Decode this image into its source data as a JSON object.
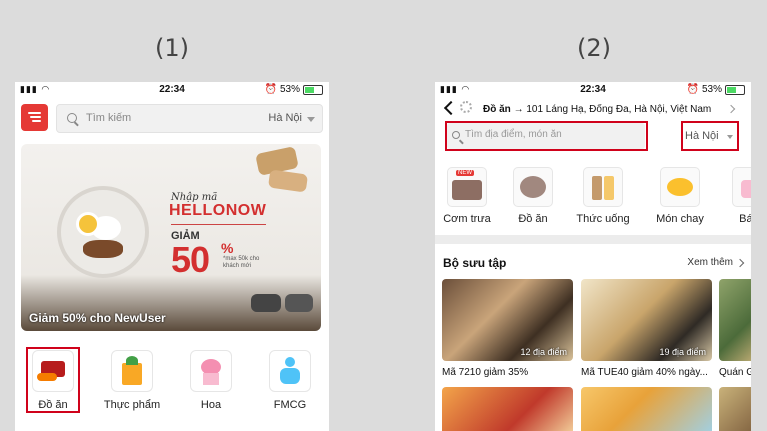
{
  "labels": {
    "left": "(1)",
    "right": "(2)"
  },
  "status": {
    "time": "22:34",
    "battery": "53%"
  },
  "screen1": {
    "search_placeholder": "Tìm kiếm",
    "city": "Hà Nội",
    "banner": {
      "prefix": "Nhập mã",
      "code": "HELLONOW",
      "discount_label": "GIẢM",
      "percent": "50",
      "percent_sign": "%",
      "note": "*max 50k cho khách mới",
      "caption": "Giảm 50% cho NewUser"
    },
    "categories": [
      {
        "label": "Đồ ăn",
        "icon": "food-delivery-icon"
      },
      {
        "label": "Thực phẩm",
        "icon": "grocery-bag-icon"
      },
      {
        "label": "Hoa",
        "icon": "flower-icon"
      },
      {
        "label": "FMCG",
        "icon": "baby-icon"
      }
    ]
  },
  "screen2": {
    "header_category": "Đồ ăn",
    "header_arrow": "→",
    "header_address": "101 Láng Hạ, Đống Đa, Hà Nội, Việt Nam",
    "search_placeholder": "Tìm địa điểm, món ăn",
    "city": "Hà Nội",
    "categories": [
      {
        "label": "Cơm trưa",
        "badge": "NEW"
      },
      {
        "label": "Đồ ăn"
      },
      {
        "label": "Thức uống"
      },
      {
        "label": "Món chay"
      },
      {
        "label": "Bánh"
      }
    ],
    "collection_title": "Bộ sưu tập",
    "see_more": "Xem thêm",
    "cards": [
      {
        "count": "12 địa điểm",
        "caption": "Mã 7210 giảm 35%"
      },
      {
        "count": "19 địa điểm",
        "caption": "Mã TUE40 giảm 40% ngày..."
      },
      {
        "caption": "Quán G"
      }
    ]
  },
  "colors": {
    "brand_red": "#e53935",
    "highlight_box": "#d0021b"
  }
}
